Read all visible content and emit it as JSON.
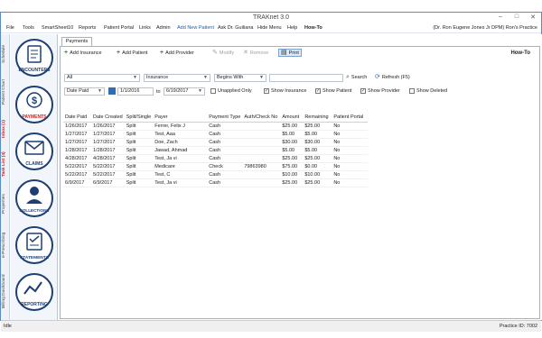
{
  "window": {
    "title": "TRAKnet 3.0"
  },
  "menu": [
    {
      "label": "File"
    },
    {
      "label": "Tools"
    },
    {
      "label": "SmartSheet10"
    },
    {
      "label": "Reports"
    },
    {
      "label": "Patient Portal"
    },
    {
      "label": "Links"
    },
    {
      "label": "Admin"
    },
    {
      "label": "Add New Patient"
    },
    {
      "label": "Ask Dr. Guiliana"
    },
    {
      "label": "Hide Menu"
    },
    {
      "label": "Help"
    },
    {
      "label": "How-To"
    }
  ],
  "user_info": "(Dr. Ron Eugene Jones Jr DPM)  Ron's Practice",
  "side_tabs": [
    "Schedule",
    "Patient Chart",
    "Inbox (1)",
    "Task List (4)",
    "Properties",
    "e-Prescribing",
    "Billing Dashboard"
  ],
  "nav_icons": [
    "ENCOUNTERS",
    "PAYMENTS",
    "CLAIMS",
    "COLLECTIONS",
    "STATEMENTS",
    "REPORTING"
  ],
  "tab_label": "Payments",
  "toolbar": {
    "add_insurance": "Add Insurance",
    "add_patient": "Add Patient",
    "add_provider": "Add Provider",
    "modify": "Modify",
    "remove": "Remove",
    "print": "Print",
    "how_to": "How-To"
  },
  "filters": {
    "scope": "All",
    "type": "Insurance",
    "match": "Begins With",
    "search_text": "",
    "search_label": "Search",
    "refresh_label": "Refresh (F5)"
  },
  "dates": {
    "field": "Date Paid",
    "from": "1/1/2016",
    "to_label": "to",
    "to": "6/19/2017"
  },
  "options": [
    {
      "label": "Unapplied Only",
      "checked": false
    },
    {
      "label": "Show Insurance",
      "checked": true
    },
    {
      "label": "Show Patient",
      "checked": true
    },
    {
      "label": "Show Provider",
      "checked": true
    },
    {
      "label": "Show Deleted",
      "checked": false
    }
  ],
  "table": {
    "columns": [
      "Date Paid",
      "Date Created",
      "Split/Single",
      "Payer",
      "Payment Type",
      "Auth/Check No",
      "Amount",
      "Remaining",
      "Patient Portal"
    ],
    "rows": [
      [
        "1/26/2017",
        "1/26/2017",
        "Split",
        "Ferrer, Felix J",
        "Cash",
        "",
        "$25.00",
        "$25.00",
        "No"
      ],
      [
        "1/27/2017",
        "1/27/2017",
        "Split",
        "Test, Aaa",
        "Cash",
        "",
        "$5.00",
        "$5.00",
        "No"
      ],
      [
        "1/27/2017",
        "1/27/2017",
        "Split",
        "Doe, Zach",
        "Cash",
        "",
        "$30.00",
        "$30.00",
        "No"
      ],
      [
        "1/28/2017",
        "1/28/2017",
        "Split",
        "Jawad, Ahmad",
        "Cash",
        "",
        "$5.00",
        "$5.00",
        "No"
      ],
      [
        "4/28/2017",
        "4/28/2017",
        "Split",
        "Test, Ja vi",
        "Cash",
        "",
        "$25.00",
        "$25.00",
        "No"
      ],
      [
        "5/22/2017",
        "5/22/2017",
        "Split",
        "Medicare",
        "Check",
        "79863980",
        "$75.00",
        "$0.00",
        "No"
      ],
      [
        "5/22/2017",
        "5/22/2017",
        "Split",
        "Test, C",
        "Cash",
        "",
        "$10.00",
        "$10.00",
        "No"
      ],
      [
        "6/9/2017",
        "6/9/2017",
        "Split",
        "Test, Ja vi",
        "Cash",
        "",
        "$25.00",
        "$25.00",
        "No"
      ]
    ]
  },
  "status": {
    "left": "Idle",
    "right": "Practice ID: 7002"
  },
  "colors": {
    "accent": "#1f5ea8",
    "alert": "#c21f1f",
    "border": "#5a8bc9"
  }
}
